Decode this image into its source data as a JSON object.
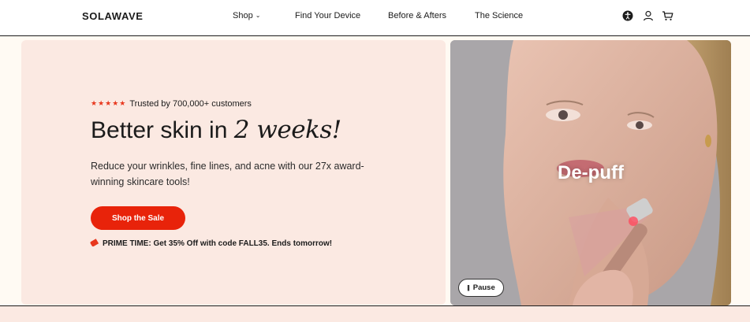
{
  "header": {
    "logo": "SOLAWAVE",
    "nav": [
      {
        "label": "Shop",
        "has_dropdown": true
      },
      {
        "label": "Find Your Device"
      },
      {
        "label": "Before & Afters"
      },
      {
        "label": "The Science"
      }
    ],
    "icons": [
      "accessibility-icon",
      "account-icon",
      "cart-icon"
    ]
  },
  "hero": {
    "rating_stars": "★★★★★",
    "trust_text": "Trusted by 700,000+ customers",
    "headline_prefix": "Better skin in ",
    "headline_accent": "2 weeks!",
    "subtext": "Reduce your wrinkles, fine lines, and acne with our 27x award-winning skincare tools!",
    "cta_label": "Shop the Sale",
    "promo_text": "PRIME TIME: Get 35% Off with code FALL35. Ends tomorrow!"
  },
  "media": {
    "overlay_text": "De-puff",
    "pause_label": "Pause"
  },
  "colors": {
    "accent": "#e8230a",
    "hero_bg": "#fbe9e2",
    "page_bg": "#fffaf3"
  }
}
